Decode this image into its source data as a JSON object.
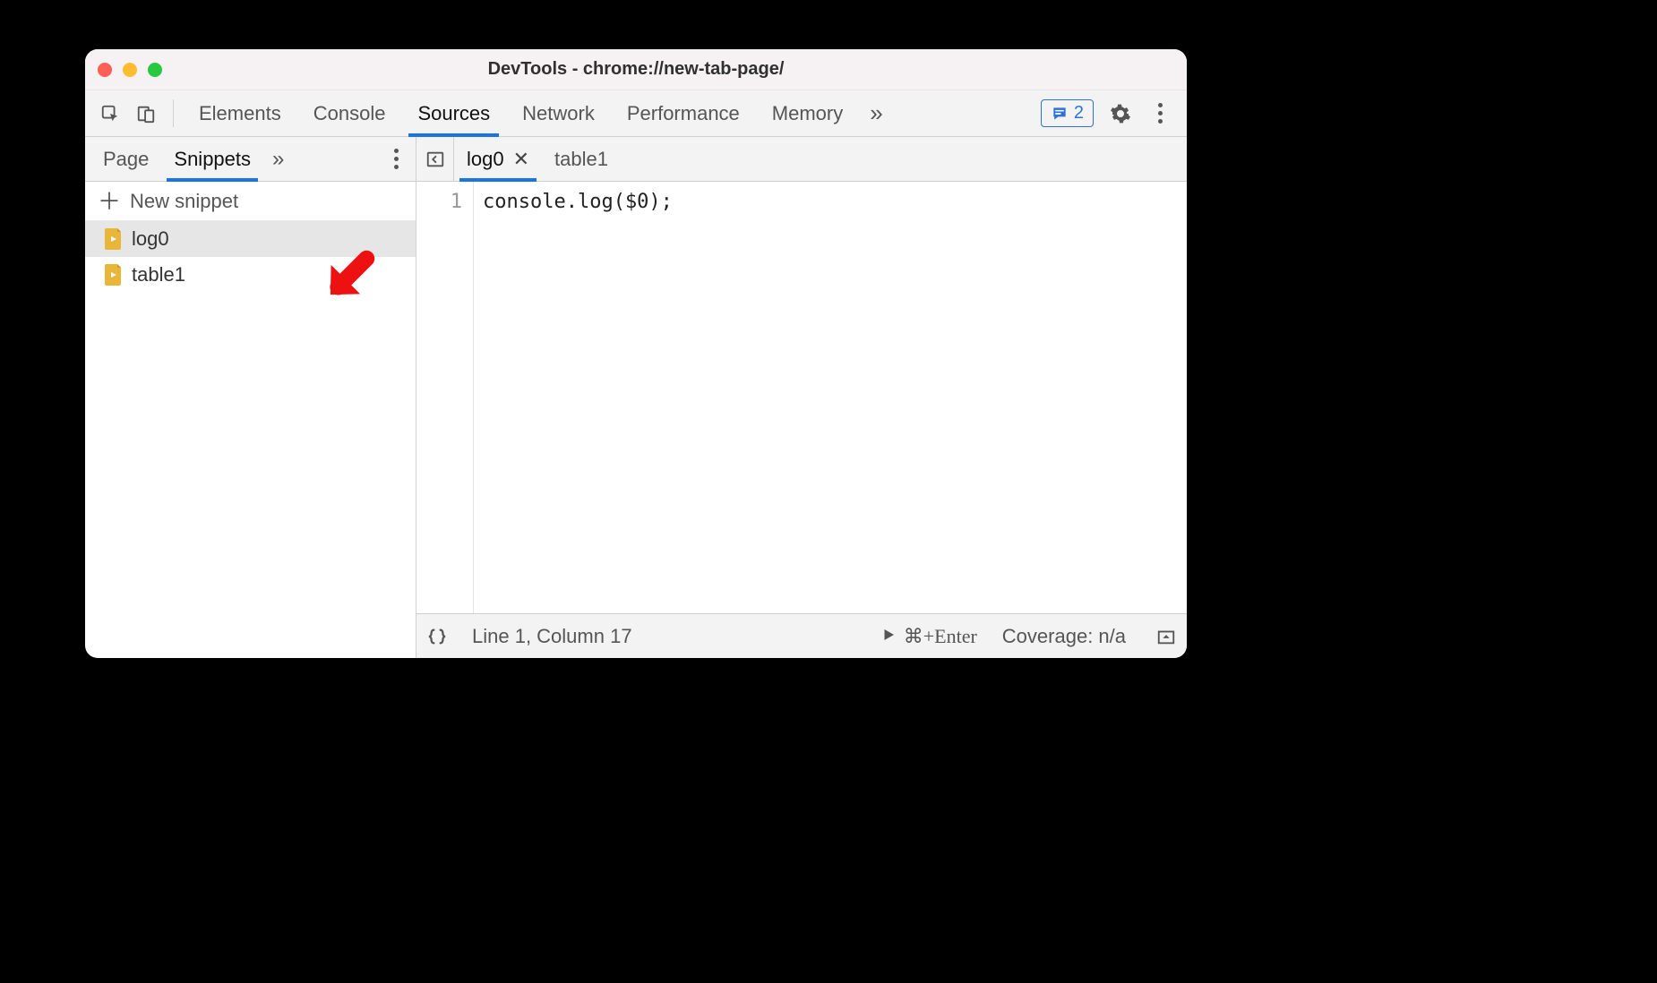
{
  "window": {
    "title": "DevTools - chrome://new-tab-page/"
  },
  "main_tabs": {
    "items": [
      "Elements",
      "Console",
      "Sources",
      "Network",
      "Performance",
      "Memory"
    ],
    "active_index": 2,
    "overflow_glyph": "»"
  },
  "messages_badge": {
    "count": "2"
  },
  "left": {
    "tabs": {
      "items": [
        "Page",
        "Snippets"
      ],
      "active_index": 1,
      "overflow_glyph": "»"
    },
    "new_snippet_label": "New snippet",
    "snippets": [
      {
        "name": "log0",
        "selected": true
      },
      {
        "name": "table1",
        "selected": false
      }
    ]
  },
  "editor": {
    "tabs": [
      {
        "name": "log0",
        "closeable": true,
        "active": true
      },
      {
        "name": "table1",
        "closeable": false,
        "active": false
      }
    ],
    "lines": [
      {
        "num": "1",
        "text": "console.log($0);"
      }
    ]
  },
  "statusbar": {
    "cursor": "Line 1, Column 17",
    "run_hint": "⌘+Enter",
    "coverage": "Coverage: n/a"
  },
  "annotation": {
    "type": "red-arrow",
    "points_to": "snippet log0"
  }
}
